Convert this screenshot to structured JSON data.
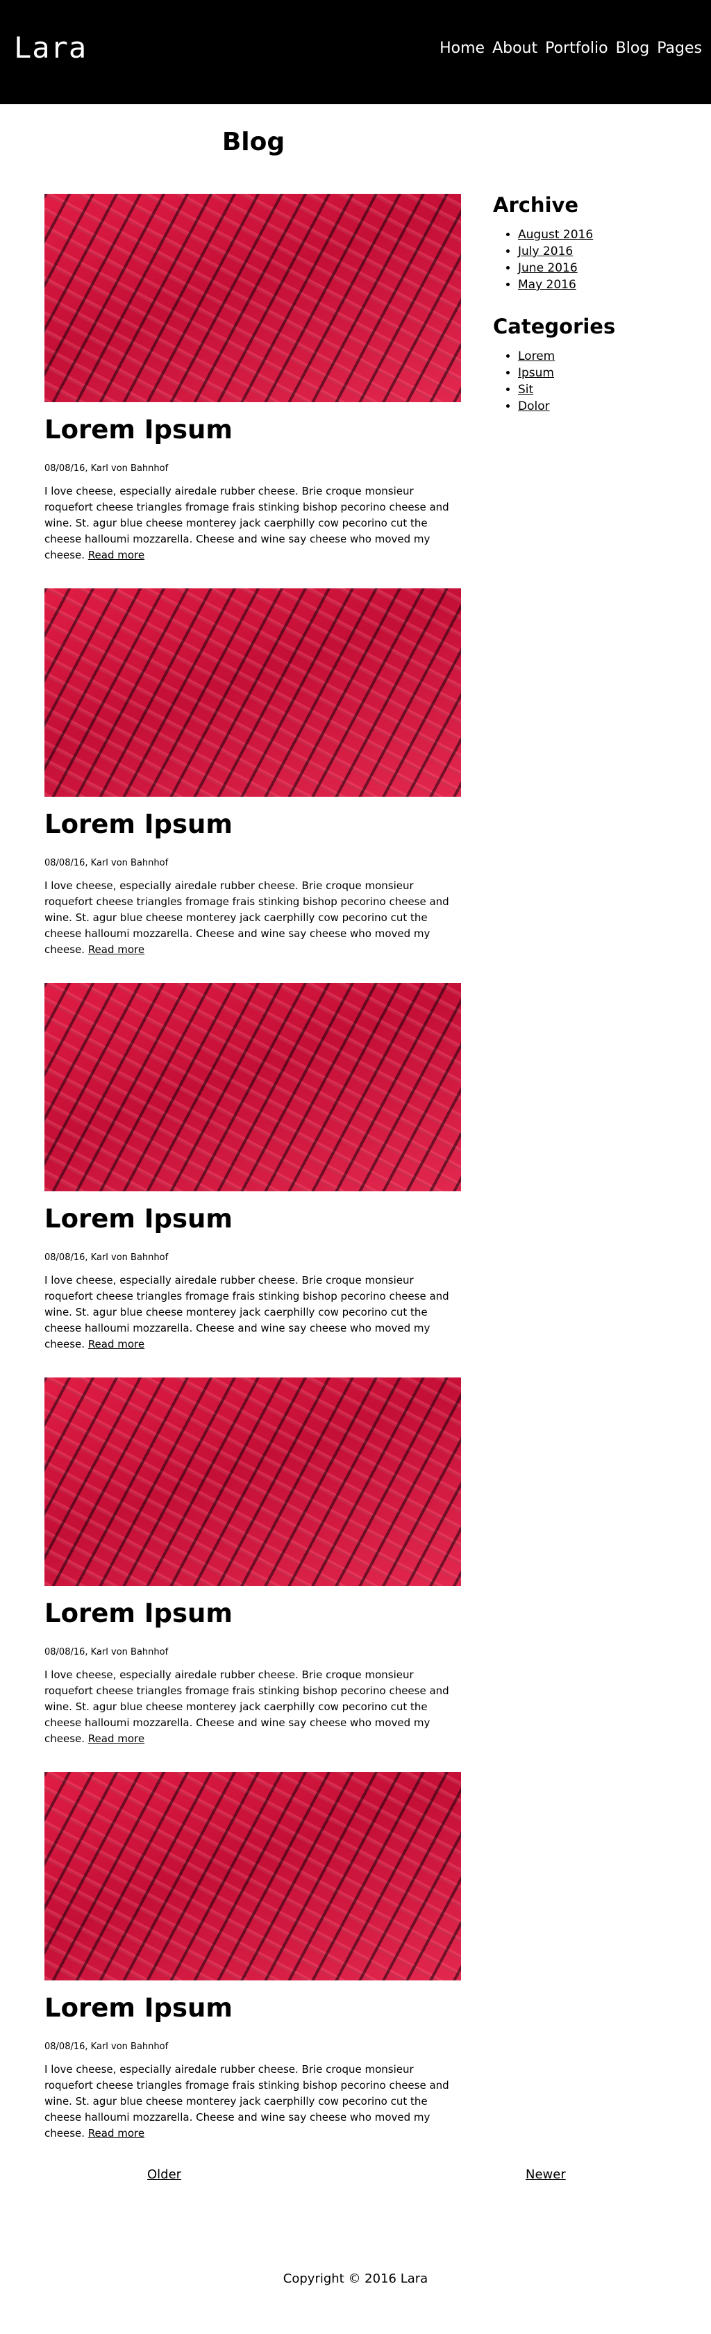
{
  "header": {
    "logo": "Lara",
    "nav": [
      "Home",
      "About",
      "Portfolio",
      "Blog",
      "Pages"
    ]
  },
  "page_title": "Blog",
  "posts": [
    {
      "title": "Lorem Ipsum",
      "meta": "08/08/16, Karl von Bahnhof",
      "body": "I love cheese, especially airedale rubber cheese. Brie croque monsieur roquefort cheese triangles fromage frais stinking bishop pecorino cheese and wine. St. agur blue cheese monterey jack caerphilly cow pecorino cut the cheese halloumi mozzarella. Cheese and wine say cheese who moved my cheese.",
      "read_more": "Read more"
    },
    {
      "title": "Lorem Ipsum",
      "meta": "08/08/16, Karl von Bahnhof",
      "body": "I love cheese, especially airedale rubber cheese. Brie croque monsieur roquefort cheese triangles fromage frais stinking bishop pecorino cheese and wine. St. agur blue cheese monterey jack caerphilly cow pecorino cut the cheese halloumi mozzarella. Cheese and wine say cheese who moved my cheese.",
      "read_more": "Read more"
    },
    {
      "title": "Lorem Ipsum",
      "meta": "08/08/16, Karl von Bahnhof",
      "body": "I love cheese, especially airedale rubber cheese. Brie croque monsieur roquefort cheese triangles fromage frais stinking bishop pecorino cheese and wine. St. agur blue cheese monterey jack caerphilly cow pecorino cut the cheese halloumi mozzarella. Cheese and wine say cheese who moved my cheese.",
      "read_more": "Read more"
    },
    {
      "title": "Lorem Ipsum",
      "meta": "08/08/16, Karl von Bahnhof",
      "body": "I love cheese, especially airedale rubber cheese. Brie croque monsieur roquefort cheese triangles fromage frais stinking bishop pecorino cheese and wine. St. agur blue cheese monterey jack caerphilly cow pecorino cut the cheese halloumi mozzarella. Cheese and wine say cheese who moved my cheese.",
      "read_more": "Read more"
    },
    {
      "title": "Lorem Ipsum",
      "meta": "08/08/16, Karl von Bahnhof",
      "body": "I love cheese, especially airedale rubber cheese. Brie croque monsieur roquefort cheese triangles fromage frais stinking bishop pecorino cheese and wine. St. agur blue cheese monterey jack caerphilly cow pecorino cut the cheese halloumi mozzarella. Cheese and wine say cheese who moved my cheese.",
      "read_more": "Read more"
    }
  ],
  "sidebar": {
    "archive_heading": "Archive",
    "archive": [
      "August 2016",
      "July 2016",
      "June 2016",
      "May 2016"
    ],
    "categories_heading": "Categories",
    "categories": [
      "Lorem",
      "Ipsum",
      "Sit",
      "Dolor"
    ]
  },
  "pagination": {
    "older": "Older",
    "newer": "Newer"
  },
  "footer": {
    "copyright": "Copyright © 2016 Lara"
  },
  "colors": {
    "header_bg": "#000000",
    "image_red": "#c8103a"
  }
}
